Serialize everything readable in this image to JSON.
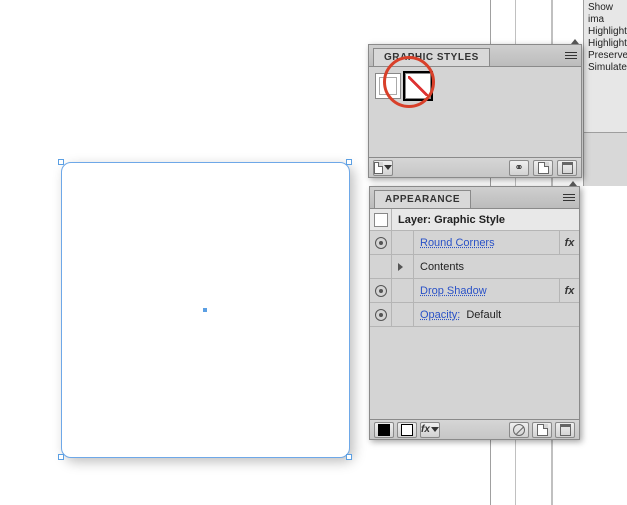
{
  "right_options": {
    "line1": "Show ima",
    "line2": "Highlight",
    "line3": "Highlight",
    "line4": "Preserve",
    "line5": "Simulate"
  },
  "graphic_styles": {
    "tab": "GRAPHIC STYLES",
    "menu_name": "panel-menu-icon",
    "swatches": [
      {
        "name": "default-graphic-style",
        "selected": false
      },
      {
        "name": "custom-graphic-style",
        "selected": true
      }
    ],
    "footer_icons": {
      "libraries": "graphic-styles-libraries-icon",
      "break_link": "break-link-icon",
      "new_style": "new-style-icon",
      "delete": "delete-style-icon"
    }
  },
  "appearance": {
    "tab": "APPEARANCE",
    "target": "Layer: Graphic Style",
    "rows": [
      {
        "label": "Round Corners",
        "link": true,
        "fx": true,
        "eye": true
      },
      {
        "label": "Contents",
        "link": false,
        "fx": false,
        "eye": false,
        "indent": true
      },
      {
        "label": "Drop Shadow",
        "link": true,
        "fx": true,
        "eye": true
      },
      {
        "label_prefix": "Opacity:",
        "label": "Default",
        "link_prefix": true,
        "fx": false,
        "eye": true
      }
    ],
    "footer_icons": {
      "new_fill": "new-fill-icon",
      "new_stroke": "new-stroke-icon",
      "add_effect": "add-effect-icon",
      "clear": "clear-appearance-icon",
      "duplicate": "duplicate-item-icon",
      "delete": "delete-item-icon"
    },
    "fx_label": "fx"
  }
}
